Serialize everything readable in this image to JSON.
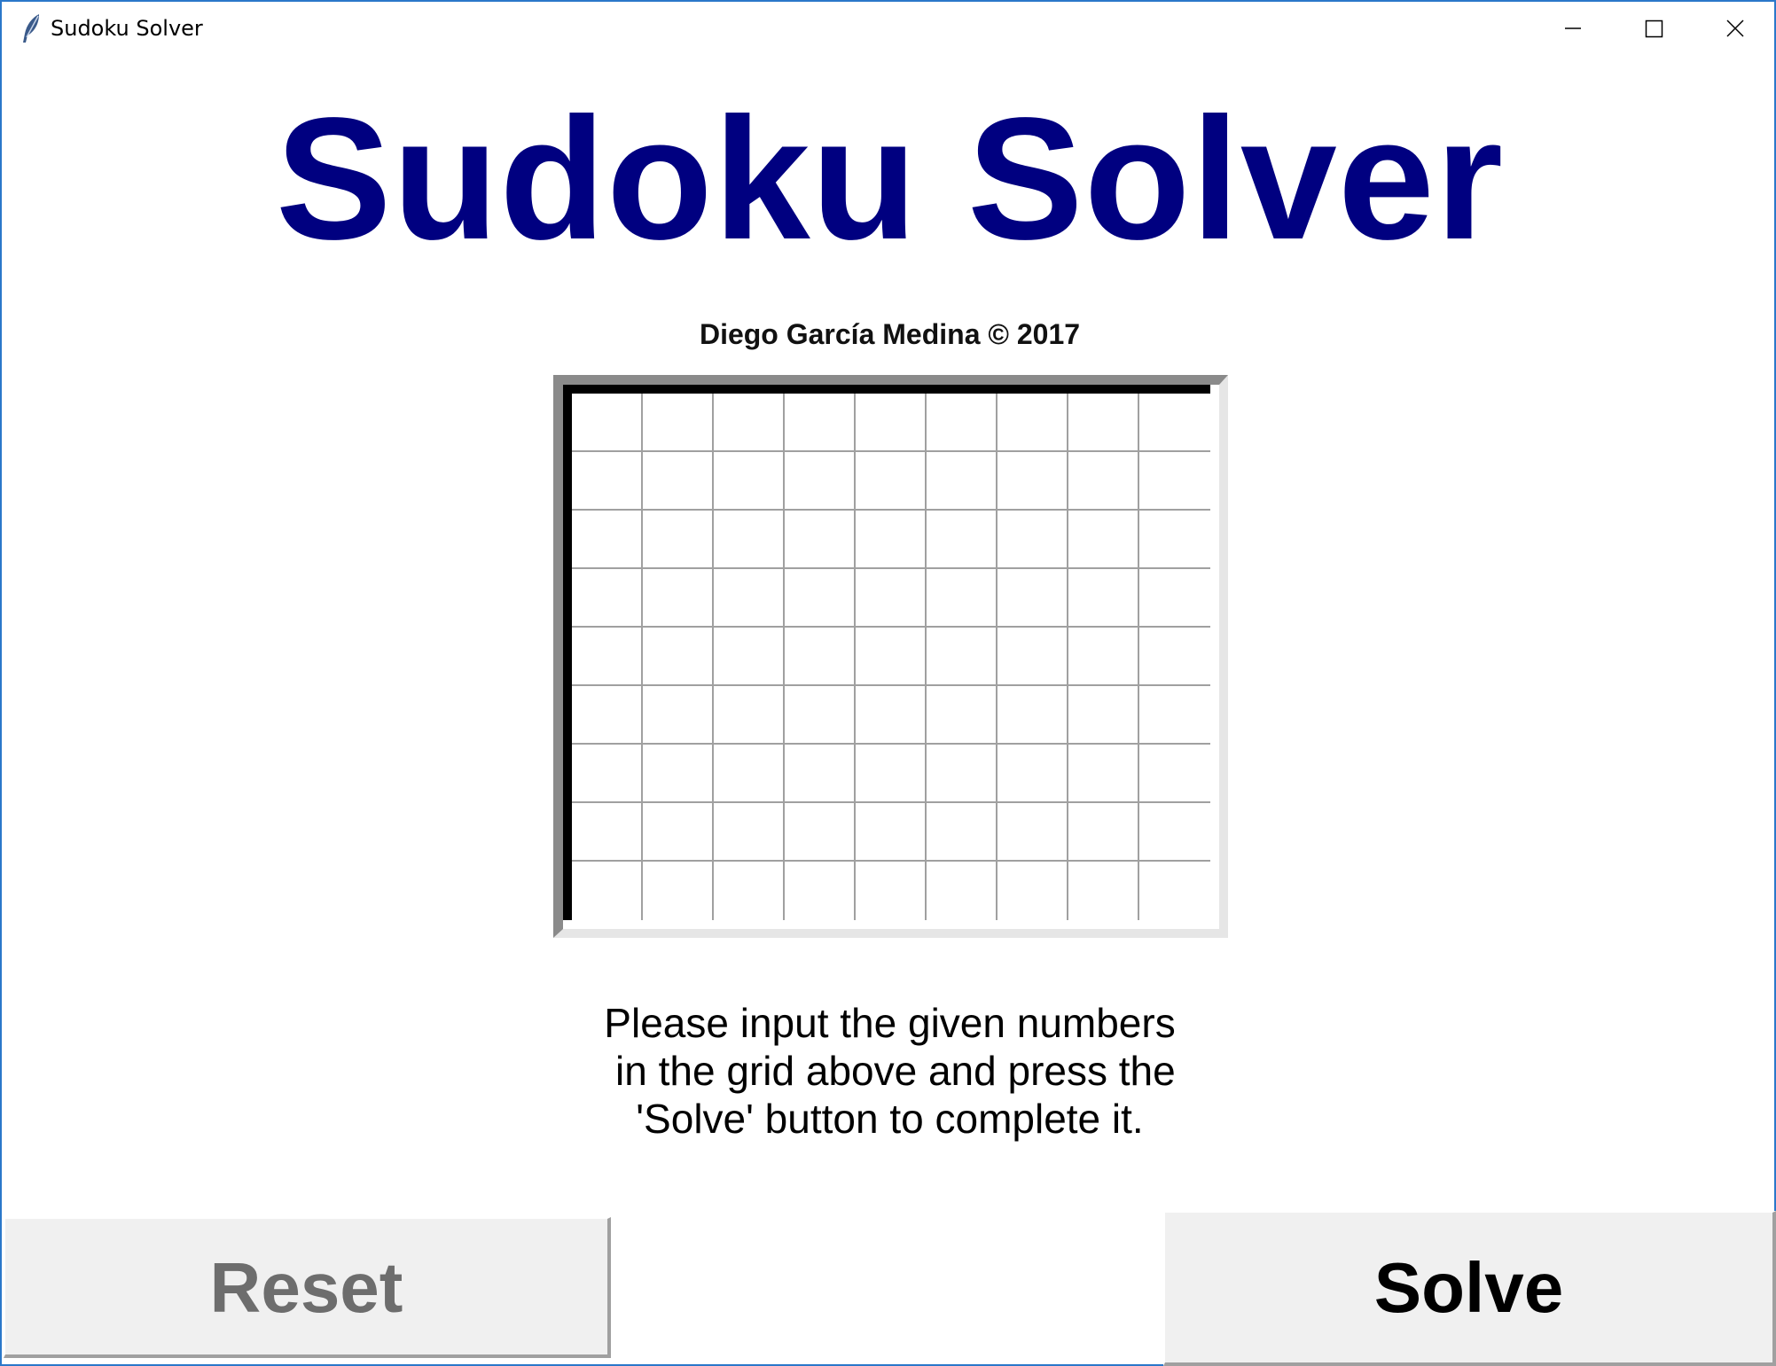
{
  "window": {
    "title": "Sudoku Solver",
    "icon": "feather-icon",
    "controls": {
      "minimize_icon": "minimize-icon",
      "maximize_icon": "maximize-icon",
      "close_icon": "close-icon"
    }
  },
  "main": {
    "title": "Sudoku Solver",
    "credit": "Diego García Medina © 2017",
    "grid": {
      "rows": 9,
      "cols": 9,
      "values": [
        [
          "",
          "",
          "",
          "",
          "",
          "",
          "",
          "",
          ""
        ],
        [
          "",
          "",
          "",
          "",
          "",
          "",
          "",
          "",
          ""
        ],
        [
          "",
          "",
          "",
          "",
          "",
          "",
          "",
          "",
          ""
        ],
        [
          "",
          "",
          "",
          "",
          "",
          "",
          "",
          "",
          ""
        ],
        [
          "",
          "",
          "",
          "",
          "",
          "",
          "",
          "",
          ""
        ],
        [
          "",
          "",
          "",
          "",
          "",
          "",
          "",
          "",
          ""
        ],
        [
          "",
          "",
          "",
          "",
          "",
          "",
          "",
          "",
          ""
        ],
        [
          "",
          "",
          "",
          "",
          "",
          "",
          "",
          "",
          ""
        ],
        [
          "",
          "",
          "",
          "",
          "",
          "",
          "",
          "",
          ""
        ]
      ]
    },
    "instructions": [
      "Please input the given numbers",
      " in the grid above and press the",
      "'Solve' button to complete it."
    ]
  },
  "buttons": {
    "reset_label": "Reset",
    "solve_label": "Solve"
  },
  "colors": {
    "title": "#000080",
    "window_border": "#2b78c9",
    "button_bg": "#f0f0f0",
    "reset_text": "#6d6d6d",
    "solve_text": "#000000"
  }
}
